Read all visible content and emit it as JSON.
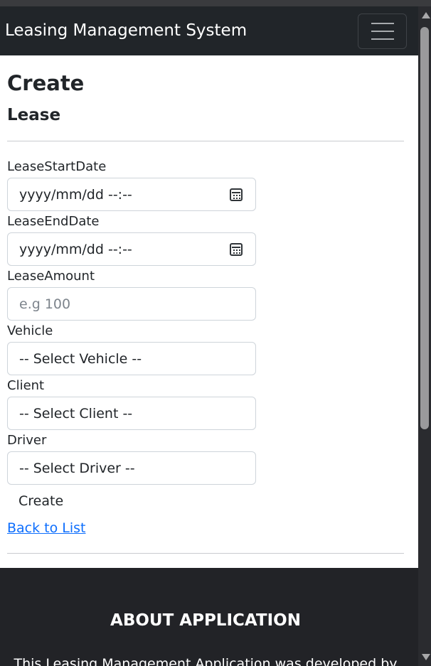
{
  "app": {
    "brand": "Leasing Management System",
    "menu_icon": "hamburger-menu-icon"
  },
  "page": {
    "title": "Create",
    "subtitle": "Lease"
  },
  "form": {
    "lease_start_date": {
      "label": "LeaseStartDate",
      "value": "yyyy/mm/dd --:--",
      "icon": "calendar-icon"
    },
    "lease_end_date": {
      "label": "LeaseEndDate",
      "value": "yyyy/mm/dd --:--",
      "icon": "calendar-icon"
    },
    "lease_amount": {
      "label": "LeaseAmount",
      "placeholder": "e.g 100",
      "value": ""
    },
    "vehicle": {
      "label": "Vehicle",
      "selected": "-- Select Vehicle --"
    },
    "client": {
      "label": "Client",
      "selected": "-- Select Client --"
    },
    "driver": {
      "label": "Driver",
      "selected": "-- Select Driver --"
    },
    "create_label": "Create",
    "back_to_list_label": "Back to List"
  },
  "footer": {
    "title": "ABOUT APPLICATION",
    "text": "This Leasing Management Application was developed by"
  },
  "colors": {
    "navbar_background": "#212529",
    "footer_background": "#222327",
    "link": "#0d6efd",
    "input_border": "#ced4da"
  }
}
